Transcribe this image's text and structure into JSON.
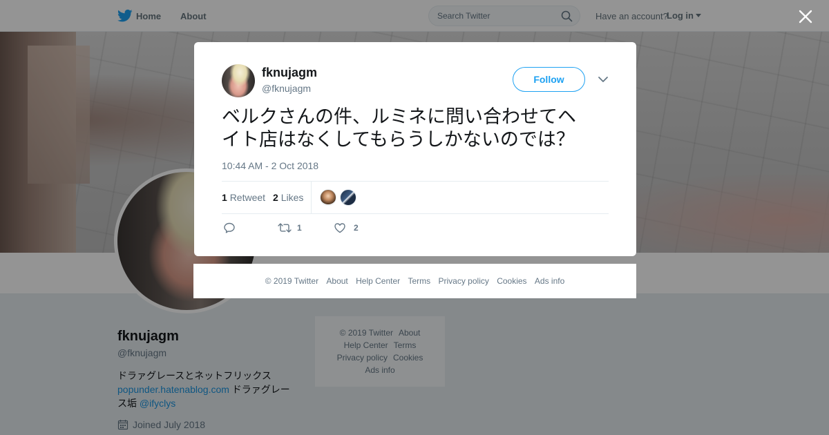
{
  "topnav": {
    "home": "Home",
    "about": "About",
    "search_placeholder": "Search Twitter",
    "have_account": "Have an account?",
    "login": "Log in"
  },
  "profile": {
    "name": "fknujagm",
    "handle": "@fknujagm",
    "bio_line1": "ドラァグレースとネットフリックス",
    "bio_link": "popunder.hatenablog.com",
    "bio_line2_rest": " ドラァグレー",
    "bio_line3": "ス垢 ",
    "bio_mention": "@ifyclys",
    "joined": "Joined July 2018"
  },
  "side_footer": {
    "copyright": "© 2019 Twitter",
    "about": "About",
    "help": "Help Center",
    "terms": "Terms",
    "privacy": "Privacy policy",
    "cookies": "Cookies",
    "ads": "Ads info"
  },
  "tweet": {
    "name": "fknujagm",
    "handle": "@fknujagm",
    "follow_label": "Follow",
    "text_line1": "ベルクさんの件、ルミネに問い合わせてヘ",
    "text_line2": "イト店はなくしてもらうしかないのでは？",
    "date": "10:44 AM - 2 Oct 2018",
    "retweet_count": "1",
    "retweet_label": "Retweet",
    "likes_count": "2",
    "likes_label": "Likes",
    "action_retweet_count": "1",
    "action_like_count": "2"
  },
  "modal_footer": {
    "copyright": "© 2019 Twitter",
    "about": "About",
    "help": "Help Center",
    "terms": "Terms",
    "privacy": "Privacy policy",
    "cookies": "Cookies",
    "ads": "Ads info"
  },
  "colors": {
    "accent": "#1da1f2",
    "link": "#1b95e0",
    "muted": "#657786"
  }
}
